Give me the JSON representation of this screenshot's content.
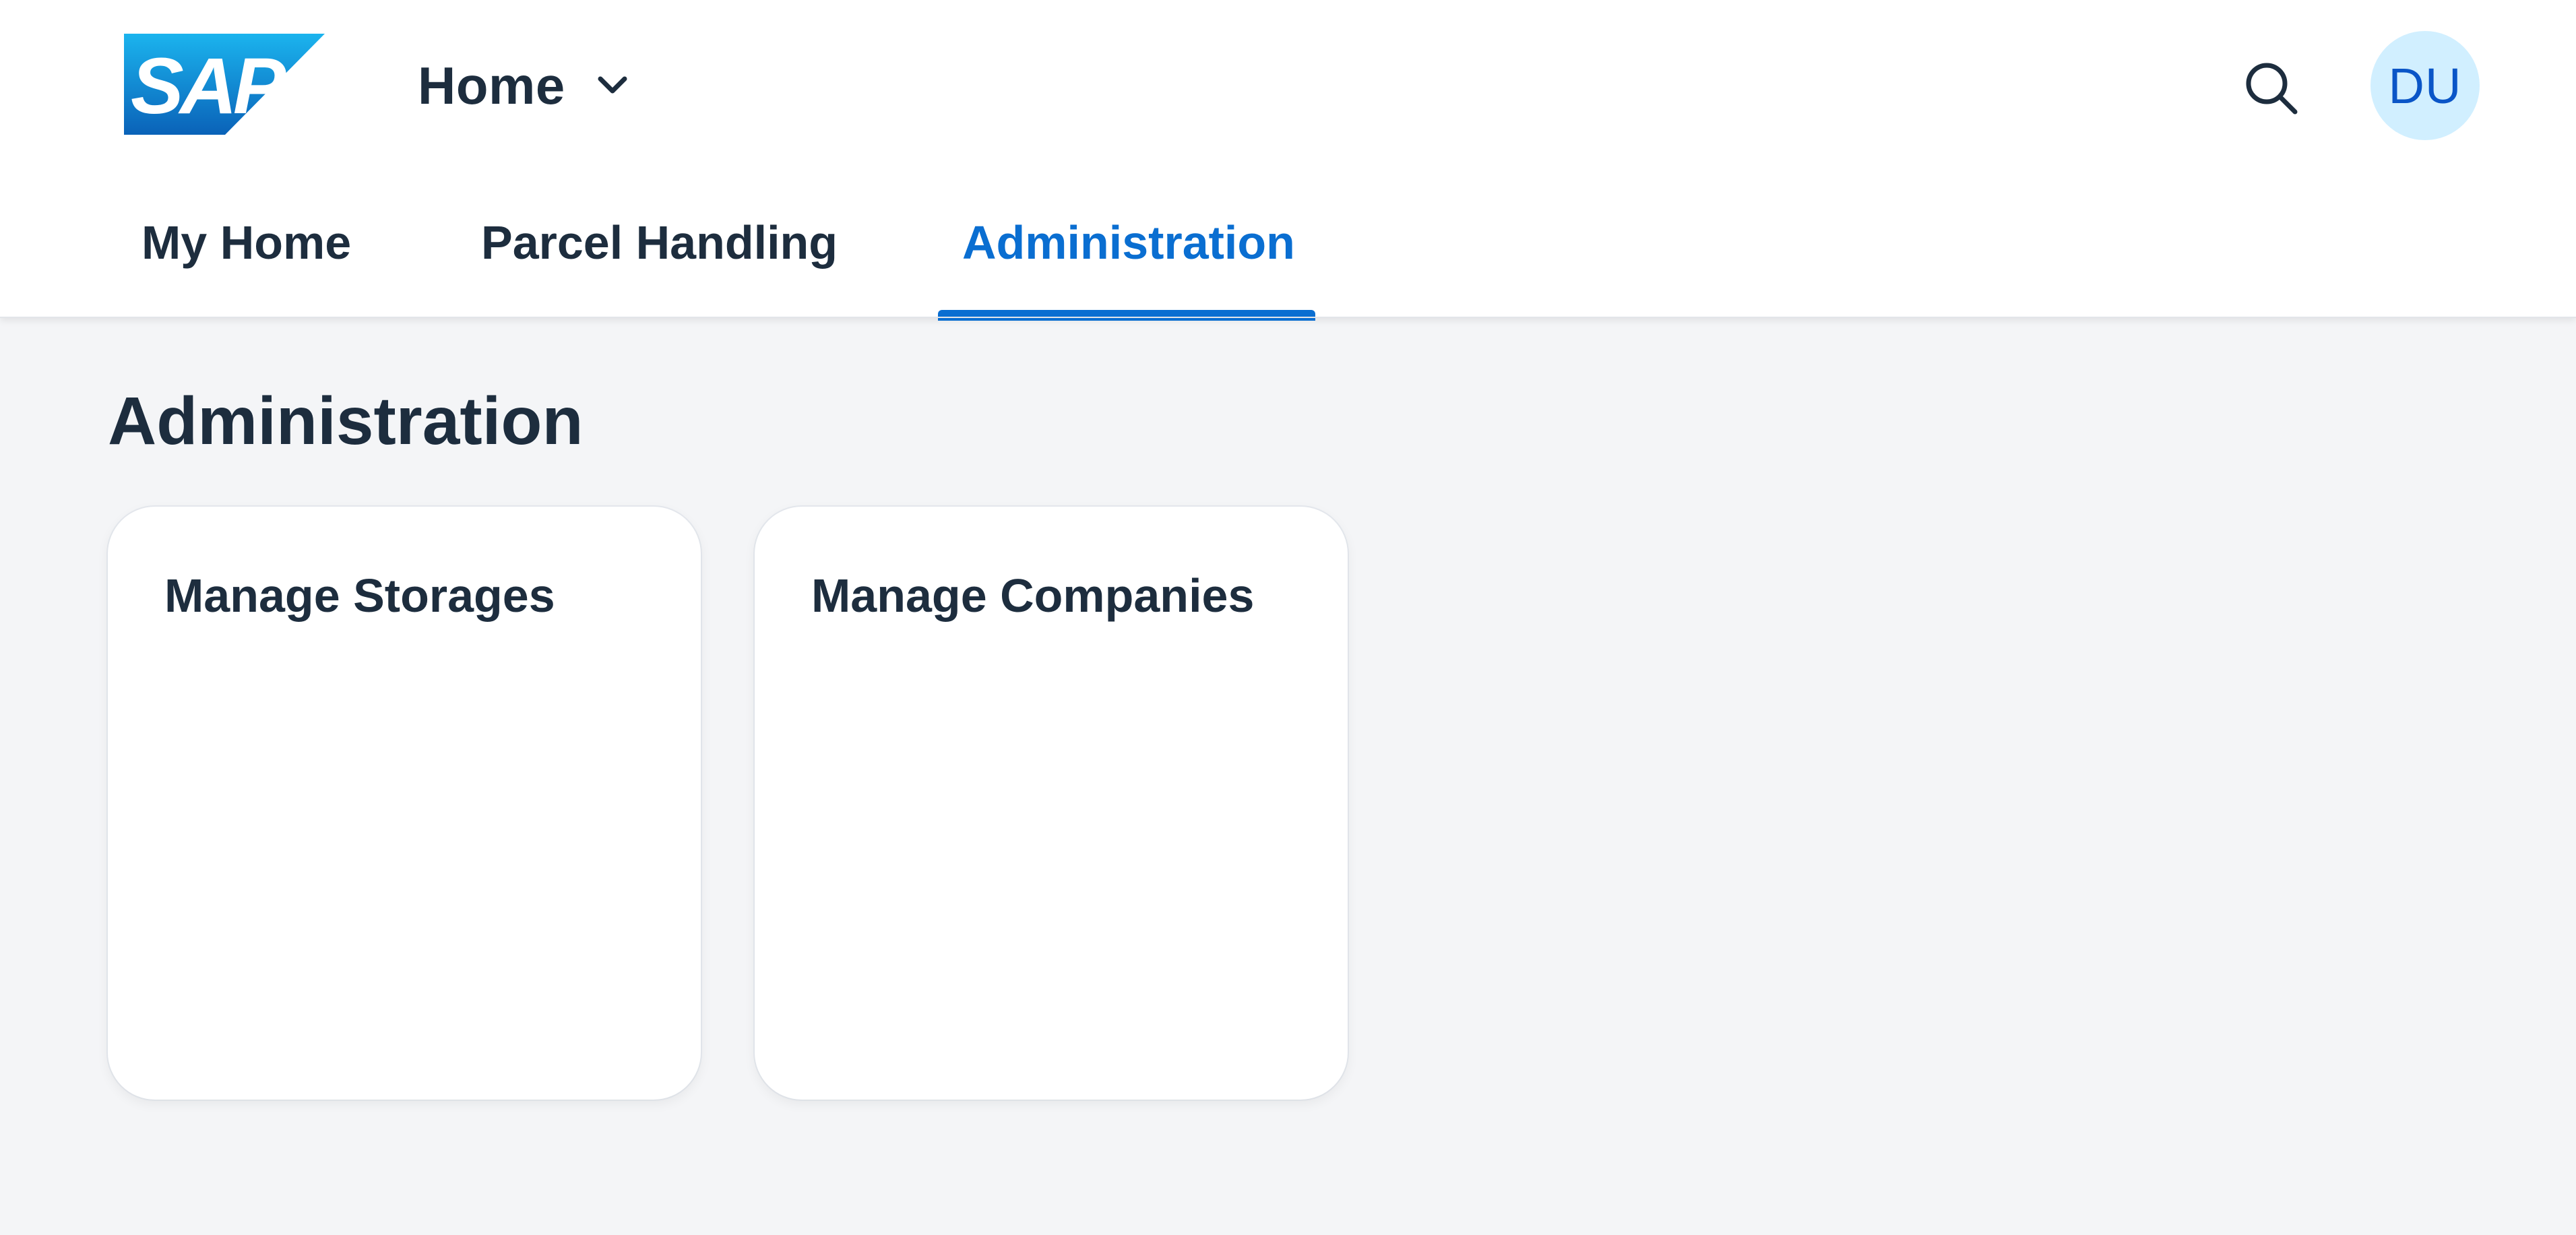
{
  "header": {
    "logo_text": "SAP",
    "home_menu_label": "Home",
    "avatar_initials": "DU"
  },
  "tabs": [
    {
      "label": "My Home",
      "selected": false
    },
    {
      "label": "Parcel Handling",
      "selected": false
    },
    {
      "label": "Administration",
      "selected": true
    }
  ],
  "page": {
    "title": "Administration"
  },
  "tiles": [
    {
      "title": "Manage Storages"
    },
    {
      "title": "Manage Companies"
    }
  ],
  "icons": {
    "search": "search-icon",
    "chevron": "chevron-down-icon"
  },
  "colors": {
    "accent": "#0a6ed1",
    "text": "#1d2d3e",
    "background": "#f4f5f7",
    "avatar_bg": "#d1efff",
    "avatar_text": "#0a55c7",
    "logo_light": "#1bb4ee",
    "logo_dark": "#0a62b8"
  }
}
